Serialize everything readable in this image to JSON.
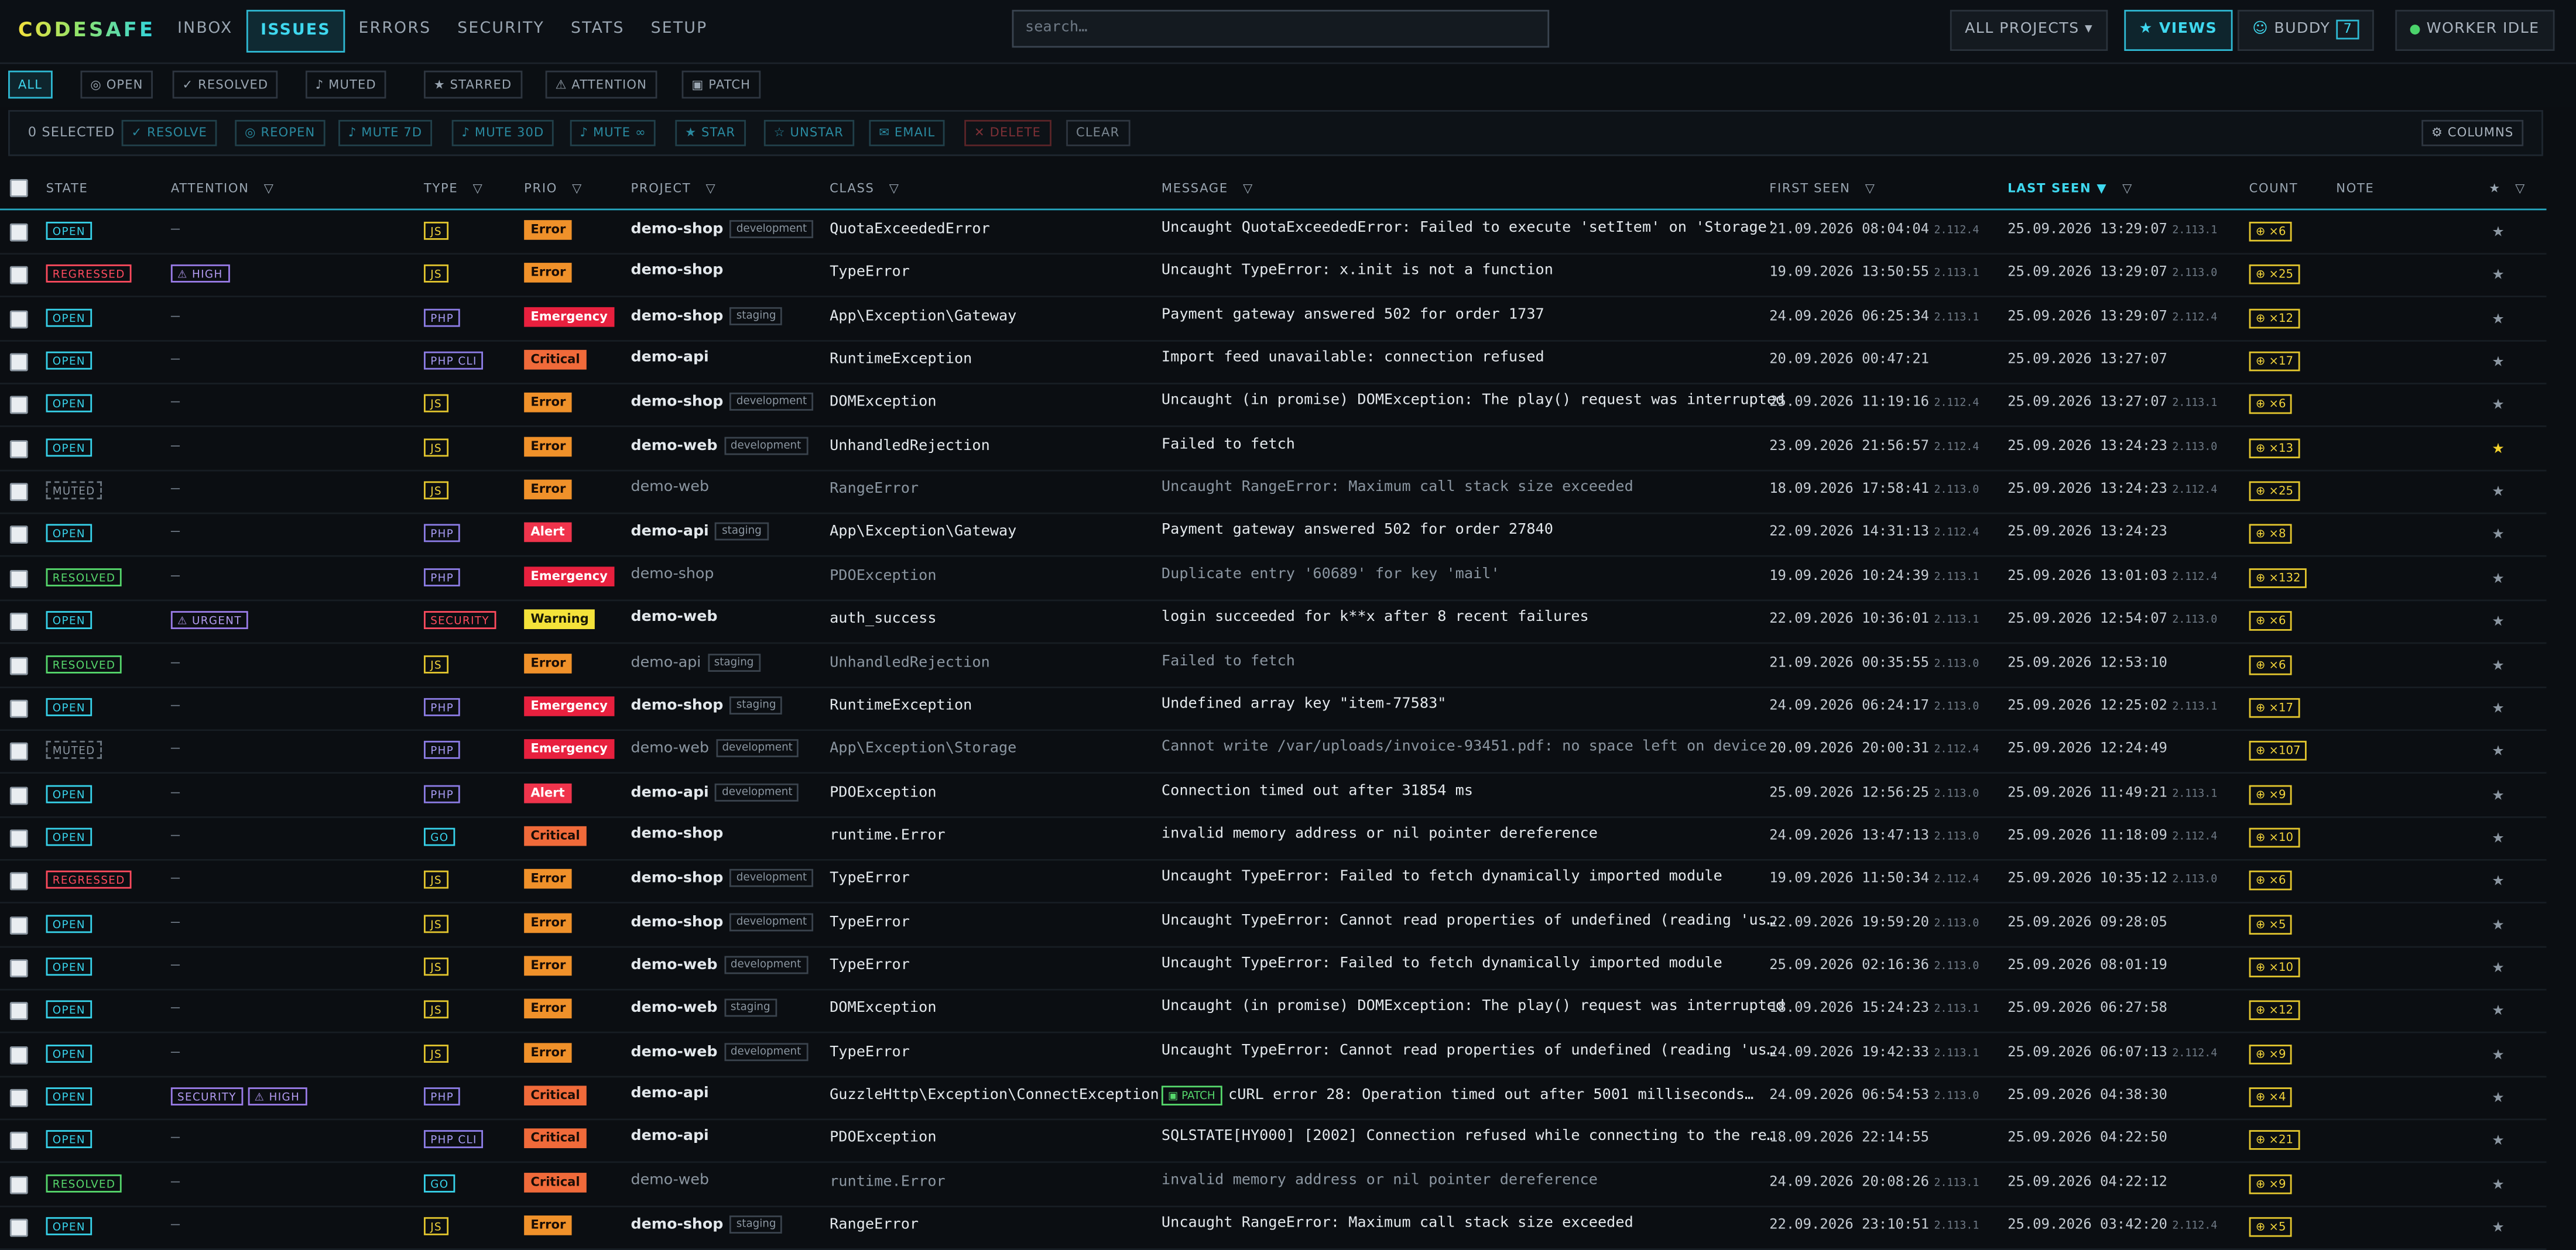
{
  "app": {
    "logo": "CODESAFE"
  },
  "nav": {
    "tabs": [
      "INBOX",
      "ISSUES",
      "ERRORS",
      "SECURITY",
      "STATS",
      "SETUP"
    ],
    "active": "ISSUES"
  },
  "search": {
    "placeholder": "search…"
  },
  "toolbar": {
    "projects_label": "ALL PROJECTS",
    "views_label": "VIEWS",
    "buddy_label": "BUDDY",
    "buddy_key": "7",
    "worker_label": "WORKER IDLE"
  },
  "filters": [
    "ALL",
    "OPEN",
    "RESOLVED",
    "MUTED",
    "STARRED",
    "ATTENTION",
    "PATCH"
  ],
  "bulk": {
    "selected": "0 SELECTED",
    "actions": [
      "RESOLVE",
      "REOPEN",
      "MUTE 7D",
      "MUTE 30D",
      "MUTE ∞",
      "STAR",
      "UNSTAR",
      "EMAIL",
      "DELETE",
      "CLEAR"
    ],
    "columns_label": "COLUMNS"
  },
  "columns": {
    "state": "STATE",
    "attention": "ATTENTION",
    "type": "TYPE",
    "prio": "PRIO",
    "project": "PROJECT",
    "class": "CLASS",
    "message": "MESSAGE",
    "first_seen": "FIRST SEEN",
    "last_seen": "LAST SEEN",
    "count": "COUNT",
    "note": "NOTE"
  },
  "rows": [
    {
      "state": "OPEN",
      "attention": [],
      "type": "JS",
      "prio": "Error",
      "project": "demo-shop",
      "env": "development",
      "class": "QuotaExceededError",
      "patch": "",
      "message": "Uncaught QuotaExceededError: Failed to execute 'setItem' on 'Storage'",
      "first": "21.09.2026 08:04:04",
      "first_ver": "2.112.4",
      "last": "25.09.2026 13:29:07",
      "last_ver": "2.113.1",
      "count": "×6",
      "starred": false,
      "dim": false
    },
    {
      "state": "REGRESSED",
      "attention": [
        "⚠ HIGH"
      ],
      "type": "JS",
      "prio": "Error",
      "project": "demo-shop",
      "env": "",
      "class": "TypeError",
      "patch": "",
      "message": "Uncaught TypeError: x.init is not a function",
      "first": "19.09.2026 13:50:55",
      "first_ver": "2.113.1",
      "last": "25.09.2026 13:29:07",
      "last_ver": "2.113.0",
      "count": "×25",
      "starred": false,
      "dim": false
    },
    {
      "state": "OPEN",
      "attention": [],
      "type": "PHP",
      "prio": "Emergency",
      "project": "demo-shop",
      "env": "staging",
      "class": "App\\Exception\\Gateway",
      "patch": "",
      "message": "Payment gateway answered 502 for order 1737",
      "first": "24.09.2026 06:25:34",
      "first_ver": "2.113.1",
      "last": "25.09.2026 13:29:07",
      "last_ver": "2.112.4",
      "count": "×12",
      "starred": false,
      "dim": false
    },
    {
      "state": "OPEN",
      "attention": [],
      "type": "PHP CLI",
      "prio": "Critical",
      "project": "demo-api",
      "env": "",
      "class": "RuntimeException",
      "patch": "",
      "message": "Import feed unavailable: connection refused",
      "first": "20.09.2026 00:47:21",
      "first_ver": "",
      "last": "25.09.2026 13:27:07",
      "last_ver": "",
      "count": "×17",
      "starred": false,
      "dim": false
    },
    {
      "state": "OPEN",
      "attention": [],
      "type": "JS",
      "prio": "Error",
      "project": "demo-shop",
      "env": "development",
      "class": "DOMException",
      "patch": "",
      "message": "Uncaught (in promise) DOMException: The play() request was interrupted",
      "first": "25.09.2026 11:19:16",
      "first_ver": "2.112.4",
      "last": "25.09.2026 13:27:07",
      "last_ver": "2.113.1",
      "count": "×6",
      "starred": false,
      "dim": false
    },
    {
      "state": "OPEN",
      "attention": [],
      "type": "JS",
      "prio": "Error",
      "project": "demo-web",
      "env": "development",
      "class": "UnhandledRejection",
      "patch": "",
      "message": "Failed to fetch",
      "first": "23.09.2026 21:56:57",
      "first_ver": "2.112.4",
      "last": "25.09.2026 13:24:23",
      "last_ver": "2.113.0",
      "count": "×13",
      "starred": true,
      "dim": false
    },
    {
      "state": "MUTED",
      "attention": [],
      "type": "JS",
      "prio": "Error",
      "project": "demo-web",
      "env": "",
      "class": "RangeError",
      "patch": "",
      "message": "Uncaught RangeError: Maximum call stack size exceeded",
      "first": "18.09.2026 17:58:41",
      "first_ver": "2.113.0",
      "last": "25.09.2026 13:24:23",
      "last_ver": "2.112.4",
      "count": "×25",
      "starred": false,
      "dim": true
    },
    {
      "state": "OPEN",
      "attention": [],
      "type": "PHP",
      "prio": "Alert",
      "project": "demo-api",
      "env": "staging",
      "class": "App\\Exception\\Gateway",
      "patch": "",
      "message": "Payment gateway answered 502 for order 27840",
      "first": "22.09.2026 14:31:13",
      "first_ver": "2.112.4",
      "last": "25.09.2026 13:24:23",
      "last_ver": "",
      "count": "×8",
      "starred": false,
      "dim": false
    },
    {
      "state": "RESOLVED",
      "attention": [],
      "type": "PHP",
      "prio": "Emergency",
      "project": "demo-shop",
      "env": "",
      "class": "PDOException",
      "patch": "",
      "message": "Duplicate entry '60689' for key 'mail'",
      "first": "19.09.2026 10:24:39",
      "first_ver": "2.113.1",
      "last": "25.09.2026 13:01:03",
      "last_ver": "2.112.4",
      "count": "×132",
      "starred": false,
      "dim": true
    },
    {
      "state": "OPEN",
      "attention": [
        "⚠ URGENT"
      ],
      "type": "SECURITY",
      "prio": "Warning",
      "project": "demo-web",
      "env": "",
      "class": "auth_success",
      "patch": "",
      "message": "login succeeded for k**x after 8 recent failures",
      "first": "22.09.2026 10:36:01",
      "first_ver": "2.113.1",
      "last": "25.09.2026 12:54:07",
      "last_ver": "2.113.0",
      "count": "×6",
      "starred": false,
      "dim": false
    },
    {
      "state": "RESOLVED",
      "attention": [],
      "type": "JS",
      "prio": "Error",
      "project": "demo-api",
      "env": "staging",
      "class": "UnhandledRejection",
      "patch": "",
      "message": "Failed to fetch",
      "first": "21.09.2026 00:35:55",
      "first_ver": "2.113.0",
      "last": "25.09.2026 12:53:10",
      "last_ver": "",
      "count": "×6",
      "starred": false,
      "dim": true
    },
    {
      "state": "OPEN",
      "attention": [],
      "type": "PHP",
      "prio": "Emergency",
      "project": "demo-shop",
      "env": "staging",
      "class": "RuntimeException",
      "patch": "",
      "message": "Undefined array key \"item-77583\"",
      "first": "24.09.2026 06:24:17",
      "first_ver": "2.113.0",
      "last": "25.09.2026 12:25:02",
      "last_ver": "2.113.1",
      "count": "×17",
      "starred": false,
      "dim": false
    },
    {
      "state": "MUTED",
      "attention": [],
      "type": "PHP",
      "prio": "Emergency",
      "project": "demo-web",
      "env": "development",
      "class": "App\\Exception\\Storage",
      "patch": "",
      "message": "Cannot write /var/uploads/invoice-93451.pdf: no space left on device",
      "first": "20.09.2026 20:00:31",
      "first_ver": "2.112.4",
      "last": "25.09.2026 12:24:49",
      "last_ver": "",
      "count": "×107",
      "starred": false,
      "dim": true
    },
    {
      "state": "OPEN",
      "attention": [],
      "type": "PHP",
      "prio": "Alert",
      "project": "demo-api",
      "env": "development",
      "class": "PDOException",
      "patch": "",
      "message": "Connection timed out after 31854 ms",
      "first": "25.09.2026 12:56:25",
      "first_ver": "2.113.0",
      "last": "25.09.2026 11:49:21",
      "last_ver": "2.113.1",
      "count": "×9",
      "starred": false,
      "dim": false
    },
    {
      "state": "OPEN",
      "attention": [],
      "type": "GO",
      "prio": "Critical",
      "project": "demo-shop",
      "env": "",
      "class": "runtime.Error",
      "patch": "",
      "message": "invalid memory address or nil pointer dereference",
      "first": "24.09.2026 13:47:13",
      "first_ver": "2.113.0",
      "last": "25.09.2026 11:18:09",
      "last_ver": "2.112.4",
      "count": "×10",
      "starred": false,
      "dim": false
    },
    {
      "state": "REGRESSED",
      "attention": [],
      "type": "JS",
      "prio": "Error",
      "project": "demo-shop",
      "env": "development",
      "class": "TypeError",
      "patch": "",
      "message": "Uncaught TypeError: Failed to fetch dynamically imported module",
      "first": "19.09.2026 11:50:34",
      "first_ver": "2.112.4",
      "last": "25.09.2026 10:35:12",
      "last_ver": "2.113.0",
      "count": "×6",
      "starred": false,
      "dim": false
    },
    {
      "state": "OPEN",
      "attention": [],
      "type": "JS",
      "prio": "Error",
      "project": "demo-shop",
      "env": "development",
      "class": "TypeError",
      "patch": "",
      "message": "Uncaught TypeError: Cannot read properties of undefined (reading 'us…",
      "first": "22.09.2026 19:59:20",
      "first_ver": "2.113.0",
      "last": "25.09.2026 09:28:05",
      "last_ver": "",
      "count": "×5",
      "starred": false,
      "dim": false
    },
    {
      "state": "OPEN",
      "attention": [],
      "type": "JS",
      "prio": "Error",
      "project": "demo-web",
      "env": "development",
      "class": "TypeError",
      "patch": "",
      "message": "Uncaught TypeError: Failed to fetch dynamically imported module",
      "first": "25.09.2026 02:16:36",
      "first_ver": "2.113.0",
      "last": "25.09.2026 08:01:19",
      "last_ver": "",
      "count": "×10",
      "starred": false,
      "dim": false
    },
    {
      "state": "OPEN",
      "attention": [],
      "type": "JS",
      "prio": "Error",
      "project": "demo-web",
      "env": "staging",
      "class": "DOMException",
      "patch": "",
      "message": "Uncaught (in promise) DOMException: The play() request was interrupted",
      "first": "18.09.2026 15:24:23",
      "first_ver": "2.113.1",
      "last": "25.09.2026 06:27:58",
      "last_ver": "",
      "count": "×12",
      "starred": false,
      "dim": false
    },
    {
      "state": "OPEN",
      "attention": [],
      "type": "JS",
      "prio": "Error",
      "project": "demo-web",
      "env": "development",
      "class": "TypeError",
      "patch": "",
      "message": "Uncaught TypeError: Cannot read properties of undefined (reading 'us…",
      "first": "24.09.2026 19:42:33",
      "first_ver": "2.113.1",
      "last": "25.09.2026 06:07:13",
      "last_ver": "2.112.4",
      "count": "×9",
      "starred": false,
      "dim": false
    },
    {
      "state": "OPEN",
      "attention": [
        "SECURITY",
        "⚠ HIGH"
      ],
      "type": "PHP",
      "prio": "Critical",
      "project": "demo-api",
      "env": "",
      "class": "GuzzleHttp\\Exception\\ConnectException",
      "patch": "PATCH",
      "message": "cURL error 28: Operation timed out after 5001 milliseconds…",
      "first": "24.09.2026 06:54:53",
      "first_ver": "2.113.0",
      "last": "25.09.2026 04:38:30",
      "last_ver": "",
      "count": "×4",
      "starred": false,
      "dim": false
    },
    {
      "state": "OPEN",
      "attention": [],
      "type": "PHP CLI",
      "prio": "Critical",
      "project": "demo-api",
      "env": "",
      "class": "PDOException",
      "patch": "",
      "message": "SQLSTATE[HY000] [2002] Connection refused while connecting to the re…",
      "first": "18.09.2026 22:14:55",
      "first_ver": "",
      "last": "25.09.2026 04:22:50",
      "last_ver": "",
      "count": "×21",
      "starred": false,
      "dim": false
    },
    {
      "state": "RESOLVED",
      "attention": [],
      "type": "GO",
      "prio": "Critical",
      "project": "demo-web",
      "env": "",
      "class": "runtime.Error",
      "patch": "",
      "message": "invalid memory address or nil pointer dereference",
      "first": "24.09.2026 20:08:26",
      "first_ver": "2.113.1",
      "last": "25.09.2026 04:22:12",
      "last_ver": "",
      "count": "×9",
      "starred": false,
      "dim": true
    },
    {
      "state": "OPEN",
      "attention": [],
      "type": "JS",
      "prio": "Error",
      "project": "demo-shop",
      "env": "staging",
      "class": "RangeError",
      "patch": "",
      "message": "Uncaught RangeError: Maximum call stack size exceeded",
      "first": "22.09.2026 23:10:51",
      "first_ver": "2.113.1",
      "last": "25.09.2026 03:42:20",
      "last_ver": "2.112.4",
      "count": "×5",
      "starred": false,
      "dim": false
    }
  ],
  "colors": {
    "accent": "#2fb9d3",
    "error": "#f0912a",
    "emergency": "#e8203e",
    "warning": "#f4e23a",
    "resolved": "#56d86c"
  }
}
